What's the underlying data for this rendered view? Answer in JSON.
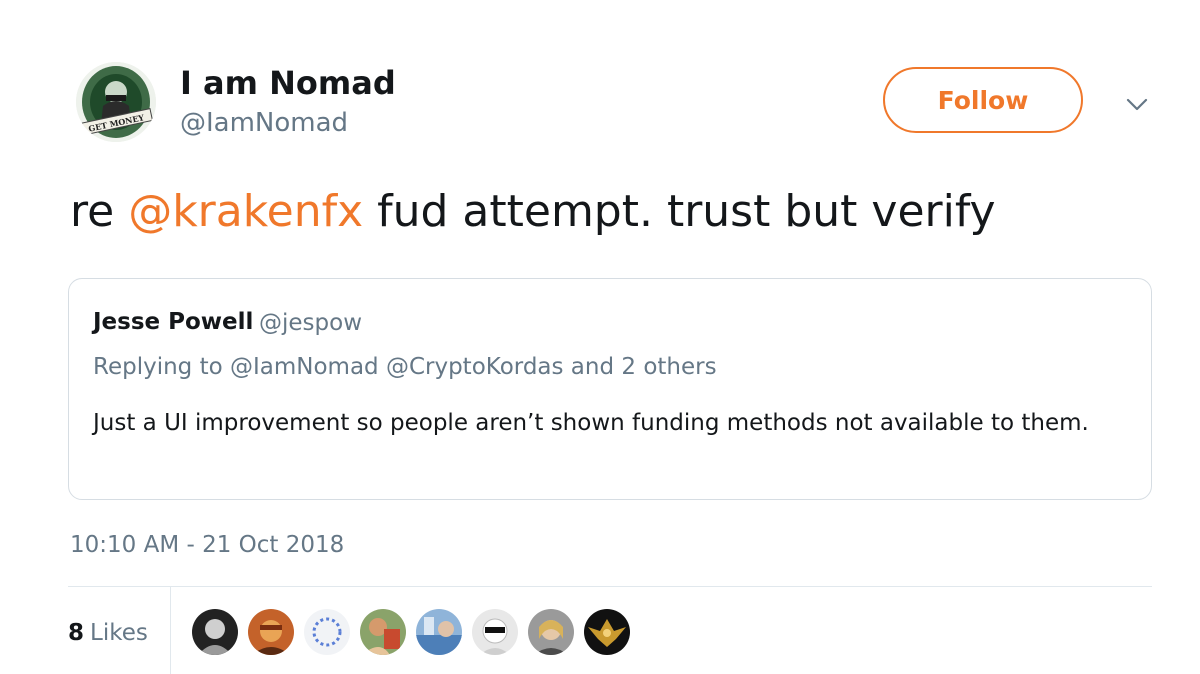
{
  "author": {
    "display_name": "I am Nomad",
    "handle": "@IamNomad",
    "avatar_icon": "money-bandit-avatar",
    "avatar_text": "GET MONEY"
  },
  "follow_label": "Follow",
  "menu_icon": "chevron-down-icon",
  "tweet": {
    "prefix": "re ",
    "mention": "@krakenfx",
    "suffix": " fud attempt. trust but verify"
  },
  "quoted": {
    "name": "Jesse Powell",
    "handle": "@jespow",
    "replying_to": "Replying to @IamNomad @CryptoKordas and 2 others",
    "body": "Just a UI improvement so people aren’t shown funding methods not available to them."
  },
  "timestamp": "10:10 AM - 21 Oct 2018",
  "likes": {
    "count": "8",
    "label": "Likes",
    "avatars": [
      "liker-avatar-1",
      "liker-avatar-2",
      "liker-avatar-3",
      "liker-avatar-4",
      "liker-avatar-5",
      "liker-avatar-6",
      "liker-avatar-7",
      "liker-avatar-8"
    ]
  },
  "colors": {
    "accent": "#f0782b",
    "text": "#14171a",
    "secondary": "#657786",
    "border": "#d6dde3"
  }
}
